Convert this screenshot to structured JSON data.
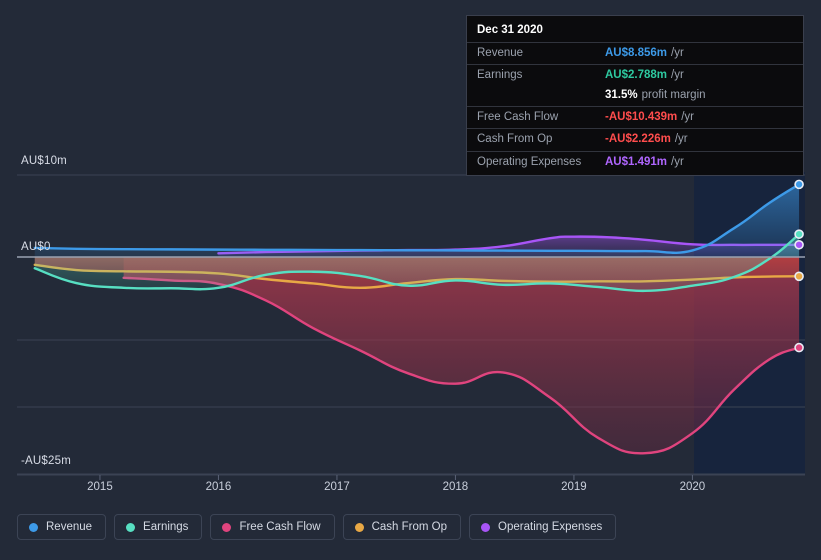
{
  "chart_data": {
    "type": "area",
    "title": "",
    "xlabel": "",
    "ylabel": "",
    "currency": "AU$",
    "unit": "m",
    "x_ticks": [
      "2015",
      "2016",
      "2017",
      "2018",
      "2019",
      "2020"
    ],
    "y_ticks": [
      "AU$10m",
      "AU$0",
      "-AU$25m"
    ],
    "y_tick_values": [
      10,
      0,
      -25
    ],
    "ylim": [
      -25,
      10
    ],
    "xlim": [
      2014.3,
      2020.95
    ],
    "grid": true,
    "legend_position": "bottom",
    "forecast_band_start": "2020",
    "series": [
      {
        "name": "Revenue",
        "color": "#3d9ae8",
        "x": [
          2014.45,
          2014.8,
          2015.2,
          2015.6,
          2016.0,
          2016.4,
          2016.8,
          2017.2,
          2017.6,
          2018.0,
          2018.4,
          2018.8,
          2019.2,
          2019.6,
          2020.0,
          2020.35,
          2020.65,
          2020.9
        ],
        "values": [
          1.1,
          1.0,
          0.95,
          0.93,
          0.9,
          0.88,
          0.86,
          0.84,
          0.82,
          0.8,
          0.78,
          0.76,
          0.74,
          0.72,
          0.8,
          3.5,
          6.6,
          8.856
        ]
      },
      {
        "name": "Earnings",
        "color": "#57dfc2",
        "x": [
          2014.45,
          2014.8,
          2015.2,
          2015.6,
          2016.0,
          2016.4,
          2016.8,
          2017.2,
          2017.6,
          2018.0,
          2018.4,
          2018.8,
          2019.2,
          2019.6,
          2020.0,
          2020.35,
          2020.65,
          2020.9
        ],
        "values": [
          -1.3,
          -3.0,
          -3.55,
          -3.6,
          -3.55,
          -2.05,
          -1.7,
          -2.2,
          -3.3,
          -2.7,
          -3.2,
          -3.05,
          -3.45,
          -3.9,
          -3.3,
          -2.3,
          -0.2,
          2.788
        ]
      },
      {
        "name": "Free Cash Flow",
        "color": "#e0447e",
        "x": [
          2015.2,
          2015.6,
          2016.0,
          2016.4,
          2016.8,
          2017.2,
          2017.6,
          2018.0,
          2018.4,
          2018.8,
          2019.2,
          2019.6,
          2020.0,
          2020.35,
          2020.65,
          2020.9
        ],
        "values": [
          -2.4,
          -2.7,
          -3.1,
          -5.0,
          -8.2,
          -10.8,
          -13.4,
          -14.6,
          -13.3,
          -16.2,
          -20.8,
          -22.6,
          -20.3,
          -15.3,
          -11.8,
          -10.439
        ]
      },
      {
        "name": "Cash From Op",
        "color": "#e8a845",
        "x": [
          2014.45,
          2014.8,
          2015.2,
          2015.6,
          2016.0,
          2016.4,
          2016.8,
          2017.2,
          2017.6,
          2018.0,
          2018.4,
          2018.8,
          2019.2,
          2019.6,
          2020.0,
          2020.35,
          2020.65,
          2020.9
        ],
        "values": [
          -0.9,
          -1.5,
          -1.65,
          -1.7,
          -1.9,
          -2.55,
          -3.05,
          -3.55,
          -3.0,
          -2.55,
          -2.75,
          -2.85,
          -2.8,
          -2.8,
          -2.6,
          -2.35,
          -2.25,
          -2.226
        ]
      },
      {
        "name": "Operating Expenses",
        "color": "#a855f7",
        "x": [
          2016.0,
          2016.4,
          2016.8,
          2017.2,
          2017.6,
          2018.0,
          2018.4,
          2018.8,
          2019.0,
          2019.3,
          2019.6,
          2020.0,
          2020.35,
          2020.65,
          2020.9
        ],
        "values": [
          0.45,
          0.6,
          0.7,
          0.78,
          0.84,
          0.9,
          1.3,
          2.3,
          2.48,
          2.4,
          2.1,
          1.55,
          1.48,
          1.49,
          1.491
        ]
      }
    ]
  },
  "tooltip": {
    "date": "Dec 31 2020",
    "rows": [
      {
        "key": "Revenue",
        "value": "AU$8.856m",
        "unit": "/yr",
        "color": "#3d9ae8"
      },
      {
        "key": "Earnings",
        "value": "AU$2.788m",
        "unit": "/yr",
        "color": "#2ec9a0"
      },
      {
        "key": "Free Cash Flow",
        "value": "-AU$10.439m",
        "unit": "/yr",
        "color": "#ff4d4d"
      },
      {
        "key": "Cash From Op",
        "value": "-AU$2.226m",
        "unit": "/yr",
        "color": "#ff4d4d"
      },
      {
        "key": "Operating Expenses",
        "value": "AU$1.491m",
        "unit": "/yr",
        "color": "#b066ff"
      }
    ],
    "margin_value": "31.5%",
    "margin_label": "profit margin"
  },
  "legend": {
    "items": [
      {
        "label": "Revenue",
        "color": "#3d9ae8"
      },
      {
        "label": "Earnings",
        "color": "#57dfc2"
      },
      {
        "label": "Free Cash Flow",
        "color": "#e0447e"
      },
      {
        "label": "Cash From Op",
        "color": "#e8a845"
      },
      {
        "label": "Operating Expenses",
        "color": "#a855f7"
      }
    ]
  },
  "colors": {
    "background": "#232a38",
    "forecast_band": "#17243d",
    "gridline": "#3b4354",
    "zero_line": "#9aa2b1"
  }
}
